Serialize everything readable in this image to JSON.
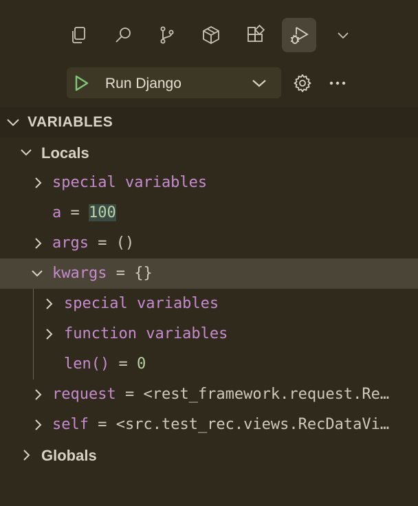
{
  "toolbar": {
    "items": [
      "explorer-icon",
      "search-icon",
      "source-control-icon",
      "extensions-package-icon",
      "extensions-icon",
      "run-debug-icon",
      "chevron-down-icon"
    ],
    "active": "run-debug-icon"
  },
  "run": {
    "config_label": "Run Django"
  },
  "panel": {
    "section_title": "VARIABLES",
    "locals_label": "Locals",
    "globals_label": "Globals",
    "rows": {
      "special_vars": "special variables",
      "a_name": "a",
      "a_eq": " = ",
      "a_value": "100",
      "args_name": "args",
      "args_eq": " = ",
      "args_value": "()",
      "kwargs_name": "kwargs",
      "kwargs_eq": " = ",
      "kwargs_value": "{}",
      "kw_special": "special variables",
      "kw_function": "function variables",
      "len_name": "len()",
      "len_eq": " = ",
      "len_value": "0",
      "request_name": "request",
      "request_eq": " = ",
      "request_value": "<rest_framework.request.Re…",
      "self_name": "self",
      "self_eq": " = ",
      "self_value": "<src.test_rec.views.RecDataVi…"
    }
  },
  "colors": {
    "background": "#2f2a1b",
    "variable_name": "#c78bd0",
    "number_value": "#b7d4a4",
    "run_icon": "#7fc77a"
  }
}
